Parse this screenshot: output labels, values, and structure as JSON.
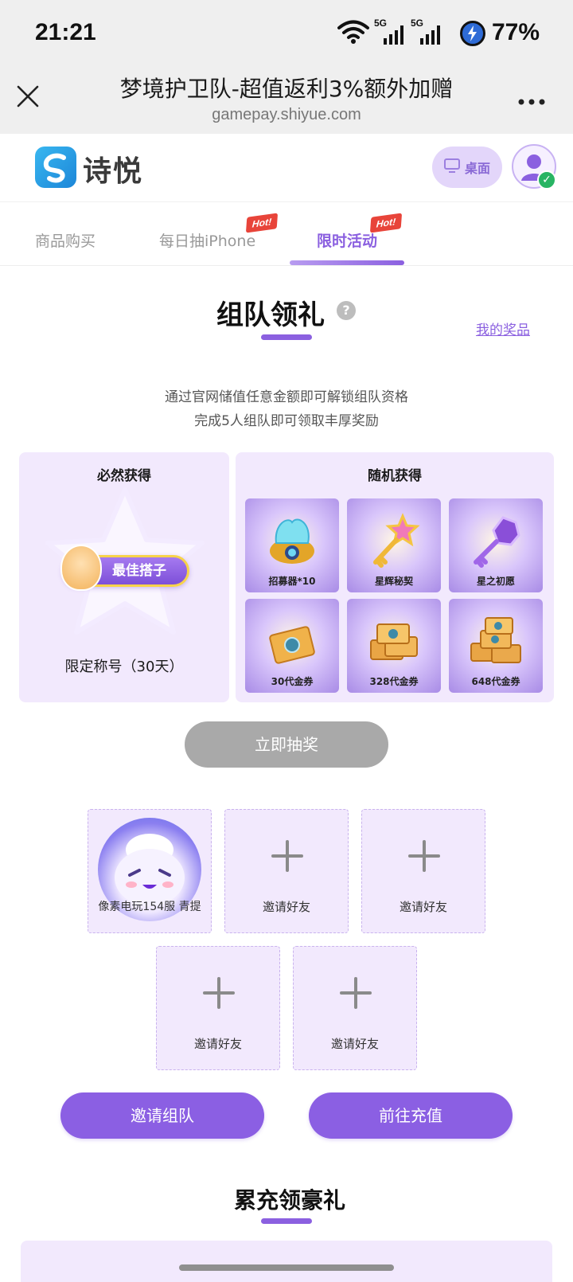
{
  "status_bar": {
    "time": "21:21",
    "network_1": "5G",
    "network_2": "5G",
    "battery": "77%"
  },
  "browser": {
    "title": "梦境护卫队-超值返利3%额外加赠",
    "url": "gamepay.shiyue.com"
  },
  "site_header": {
    "logo_text": "诗悦",
    "desktop_label": "桌面"
  },
  "tabs": [
    {
      "label": "商品购买",
      "hot": false,
      "active": false
    },
    {
      "label": "每日抽iPhone",
      "hot": true,
      "active": false
    },
    {
      "label": "限时活动",
      "hot": true,
      "active": true
    }
  ],
  "hot_label": "Hot!",
  "team_section": {
    "title": "组队领礼",
    "help": "?",
    "my_prizes": "我的奖品",
    "desc_line1": "通过官网储值任意金额即可解锁组队资格",
    "desc_line2": "完成5人组队即可领取丰厚奖励",
    "guaranteed_title": "必然获得",
    "guaranteed_badge": "最佳搭子",
    "guaranteed_label": "限定称号（30天）",
    "random_title": "随机获得",
    "random_items": [
      {
        "label": "招募器*10",
        "icon": "recruiter-icon"
      },
      {
        "label": "星辉秘契",
        "icon": "star-key-icon"
      },
      {
        "label": "星之初愿",
        "icon": "purple-key-icon"
      },
      {
        "label": "30代金券",
        "icon": "voucher-icon"
      },
      {
        "label": "328代金券",
        "icon": "voucher-stack-icon"
      },
      {
        "label": "648代金券",
        "icon": "voucher-pile-icon"
      }
    ],
    "draw_button": "立即抽奖",
    "member_name": "像素电玩154服 青提",
    "invite_label": "邀请好友",
    "invite_team_button": "邀请组队",
    "recharge_button": "前往充值"
  },
  "accumulate_section": {
    "title": "累充领豪礼"
  },
  "colors": {
    "accent": "#8b60e0",
    "panel_bg": "#f2e9fd",
    "disabled_button": "#a9a9a9"
  }
}
